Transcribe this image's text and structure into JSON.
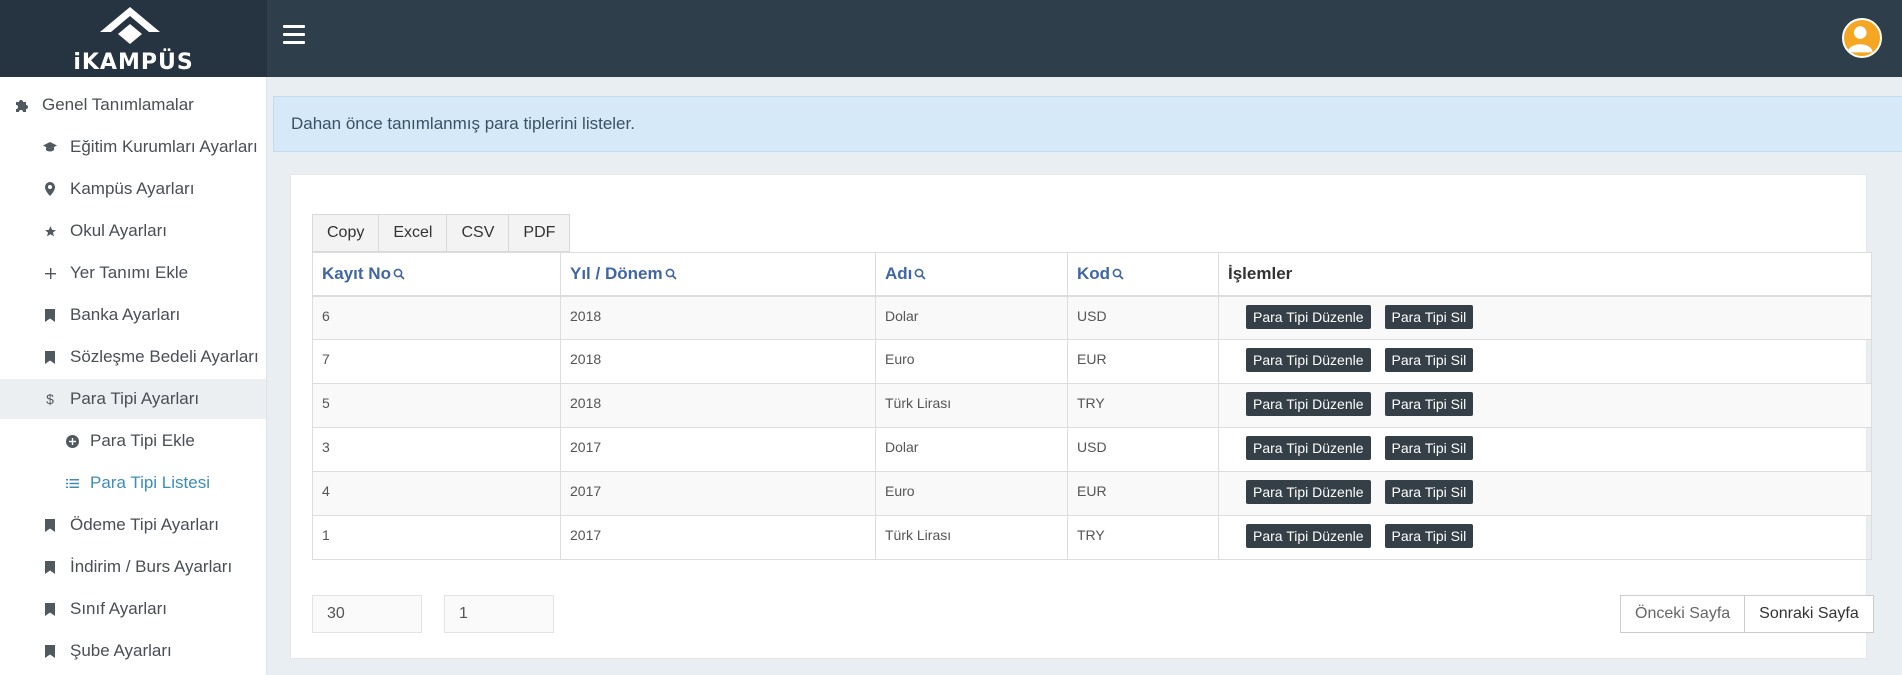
{
  "brand": {
    "name": "iKAMPÜS"
  },
  "sidebar": {
    "items": [
      {
        "label": "Genel Tanımlamalar",
        "icon": "puzzle-icon"
      },
      {
        "label": "Eğitim Kurumları Ayarları",
        "icon": "graduation-cap-icon"
      },
      {
        "label": "Kampüs Ayarları",
        "icon": "map-pin-icon"
      },
      {
        "label": "Okul Ayarları",
        "icon": "star-icon"
      },
      {
        "label": "Yer Tanımı Ekle",
        "icon": "plus-icon"
      },
      {
        "label": "Banka Ayarları",
        "icon": "bookmark-icon"
      },
      {
        "label": "Sözleşme Bedeli Ayarları",
        "icon": "bookmark-icon"
      },
      {
        "label": "Para Tipi Ayarları",
        "icon": "dollar-icon"
      },
      {
        "label": "Para Tipi Ekle",
        "icon": "plus-circle-icon"
      },
      {
        "label": "Para Tipi Listesi",
        "icon": "list-icon"
      },
      {
        "label": "Ödeme Tipi Ayarları",
        "icon": "bookmark-icon"
      },
      {
        "label": "İndirim / Burs Ayarları",
        "icon": "bookmark-icon"
      },
      {
        "label": "Sınıf Ayarları",
        "icon": "bookmark-icon"
      },
      {
        "label": "Şube Ayarları",
        "icon": "bookmark-icon"
      }
    ]
  },
  "info": {
    "text": "Dahan önce tanımlanmış para tiplerini listeler."
  },
  "export_buttons": [
    "Copy",
    "Excel",
    "CSV",
    "PDF"
  ],
  "table": {
    "columns": [
      "Kayıt No",
      "Yıl / Dönem",
      "Adı",
      "Kod",
      "İşlemler"
    ],
    "rows": [
      [
        "6",
        "2018",
        "Dolar",
        "USD"
      ],
      [
        "7",
        "2018",
        "Euro",
        "EUR"
      ],
      [
        "5",
        "2018",
        "Türk Lirası",
        "TRY"
      ],
      [
        "3",
        "2017",
        "Dolar",
        "USD"
      ],
      [
        "4",
        "2017",
        "Euro",
        "EUR"
      ],
      [
        "1",
        "2017",
        "Türk Lirası",
        "TRY"
      ]
    ],
    "edit_label": "Para Tipi Düzenle",
    "delete_label": "Para Tipi Sil"
  },
  "pagination": {
    "page_size": "30",
    "page_number": "1",
    "prev_label": "Önceki Sayfa",
    "next_label": "Sonraki Sayfa"
  },
  "colors": {
    "topbar": "#2f3e4b",
    "accent": "#3c8dbc",
    "header_link": "#4066a6",
    "action_button": "#343f47"
  }
}
